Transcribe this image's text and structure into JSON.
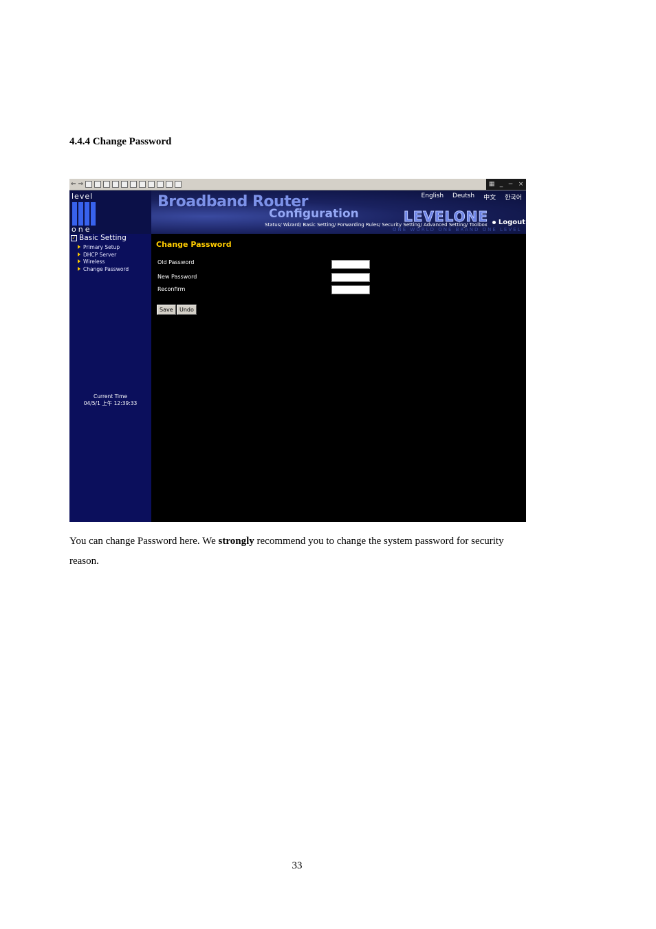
{
  "doc": {
    "section_heading": "4.4.4 Change Password",
    "paragraph": {
      "before": "You can change Password here. We ",
      "strong": "strongly",
      "after": " recommend you to change the system password for security reason."
    },
    "page_number": "33"
  },
  "screenshot": {
    "toolbar_icons": [
      "back-icon",
      "forward-icon",
      "stop-icon",
      "refresh-icon",
      "home-icon",
      "search-icon",
      "favorites-icon",
      "history-icon",
      "mail-icon",
      "print-icon",
      "edit-icon",
      "discuss-icon",
      "messenger-icon"
    ],
    "window_controls": [
      "_",
      "−",
      "×"
    ],
    "logo": {
      "top": "level",
      "bottom": "one"
    },
    "banner": {
      "title": "Broadband Router",
      "subtitle": "Configuration",
      "brand": "LEVELONE",
      "slogan": "ONE WORLD ONE BRAND ONE LEVEL",
      "languages": [
        "English",
        "Deutsh",
        "中文",
        "한국어"
      ],
      "nav": "Status/ Wizard/ Basic Setting/ Forwarding Rules/ Security Setting/ Advanced Setting/ Toolbox",
      "logout": "Logout"
    },
    "sidebar": {
      "heading": "Basic Setting",
      "items": [
        "Primary Setup",
        "DHCP Server",
        "Wireless",
        "Change Password"
      ],
      "time_label": "Current Time",
      "time_value": "04/5/1 上午 12:39:33"
    },
    "form": {
      "title": "Change Password",
      "old_password_label": "Old Password",
      "new_password_label": "New Password",
      "reconfirm_label": "Reconfirm",
      "save_label": "Save",
      "undo_label": "Undo"
    },
    "colors": {
      "sidebar": "#0b0f5c",
      "title_accent": "#ffcc00",
      "content_bg": "#000000"
    }
  }
}
